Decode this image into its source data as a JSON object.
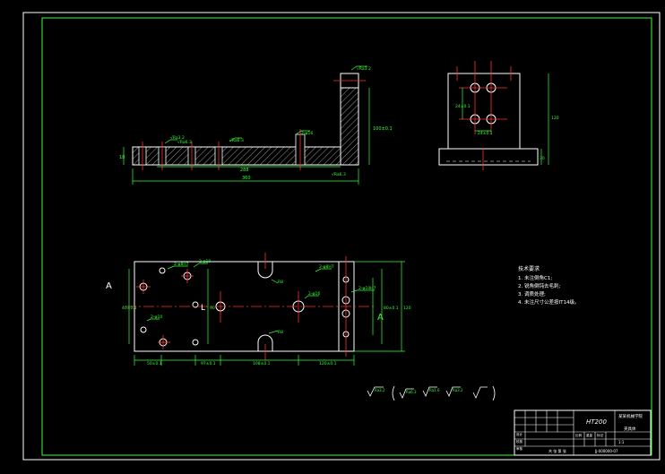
{
  "drawing": {
    "section_marks": {
      "left": "A",
      "right": "A"
    },
    "front_view": {
      "dims": {
        "overall_length": "360",
        "step_length": "288",
        "left_height": "18",
        "right_height": "100±0.1"
      },
      "surface_labels": [
        "√Ra3.2",
        "√Ra6.3",
        "√Ra6.3",
        "2-φ16",
        "√Ra3.2",
        "√Ra6.3"
      ]
    },
    "side_view": {
      "dims": {
        "hole_spacing_h": "24±0.1",
        "hole_spacing_v": "24±0.1",
        "height": "120",
        "base": "30"
      }
    },
    "plan_view": {
      "labels": {
        "hole_a": "2-φ8H7",
        "hole_b": "2-φ10",
        "hole_c": "2-φ10",
        "center": "2-φ16",
        "right_top": "2-φ8H7",
        "right_mid": "2-φ10H7",
        "slot_top": "R8",
        "slot_bottom": "R8",
        "width": "120",
        "left_v": "40±0.1",
        "right_v": "80±0.1",
        "mid_v": "90"
      },
      "bottom_dims": [
        "50±0.1",
        "97±0.1",
        "108±0.1",
        "120±0.1"
      ]
    },
    "tech_requirements": {
      "title": "技术要求",
      "items": [
        "1. 未注倒角C1;",
        "2. 锐角倒钝去毛刺;",
        "3. 调质处理;",
        "4. 未注尺寸公差按IT14级。"
      ]
    },
    "roughness_symbols": [
      "Ra3.2",
      "Ra6.3",
      "Ra1.6",
      "Ra3.2",
      "(√)"
    ],
    "title_block": {
      "material": "HT200",
      "school": "某某机械学院",
      "part_name": "夹具体",
      "drawing_no": "JJ-000000-07",
      "scale": "1:1",
      "sheet": "共 张 第 张",
      "cells": [
        "设计",
        "校核",
        "审核",
        "比例",
        "重量",
        "标记"
      ]
    }
  }
}
